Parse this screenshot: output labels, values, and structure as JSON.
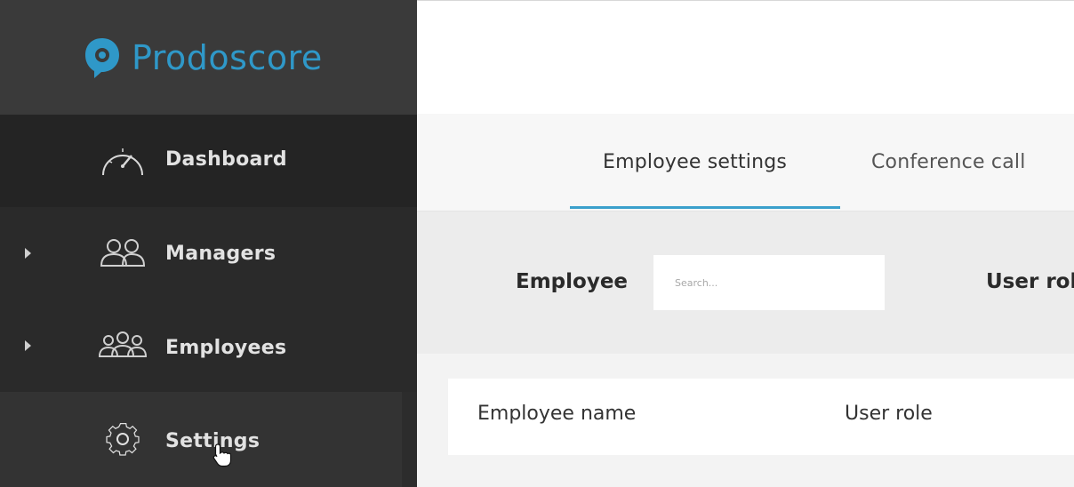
{
  "brand": {
    "name": "Prodoscore",
    "color": "#2f98c8"
  },
  "sidebar": {
    "items": [
      {
        "label": "Dashboard",
        "icon": "speedometer-icon",
        "expandable": false
      },
      {
        "label": "Managers",
        "icon": "managers-icon",
        "expandable": true
      },
      {
        "label": "Employees",
        "icon": "employees-icon",
        "expandable": true
      },
      {
        "label": "Settings",
        "icon": "gear-icon",
        "expandable": false,
        "active": true
      }
    ]
  },
  "tabs": [
    {
      "label": "Employee settings",
      "active": true
    },
    {
      "label": "Conference call",
      "active": false
    }
  ],
  "filters": {
    "employee_label": "Employee",
    "search_placeholder": "Search...",
    "user_role_label": "User rol"
  },
  "table": {
    "columns": [
      "Employee name",
      "User role"
    ]
  },
  "colors": {
    "accent": "#3ba0cc",
    "sidebar_bg": "#2b2b2b"
  }
}
